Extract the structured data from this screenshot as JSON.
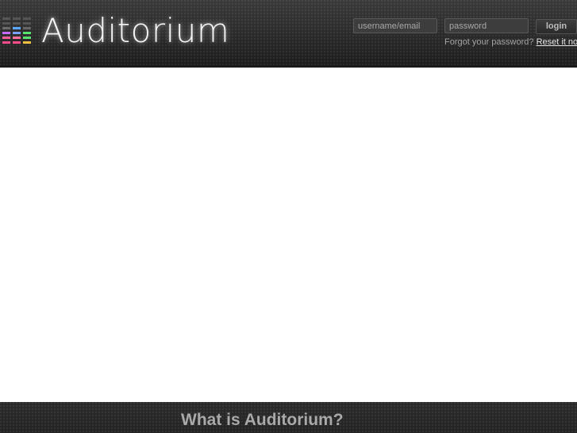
{
  "brand": {
    "name": "Auditorium",
    "logo_icon": "equalizer-bars-icon"
  },
  "login": {
    "username_placeholder": "username/email",
    "password_placeholder": "password",
    "button_label": "login",
    "forgot_text": "Forgot your password?",
    "reset_link": "Reset it now."
  },
  "section": {
    "title": "What is Auditorium?"
  },
  "colors": {
    "header_bg": "#262626",
    "bar_colors": [
      "#ff4c8b",
      "#c86bff",
      "#5aa8ff",
      "#57e36d",
      "#f0c040"
    ]
  }
}
